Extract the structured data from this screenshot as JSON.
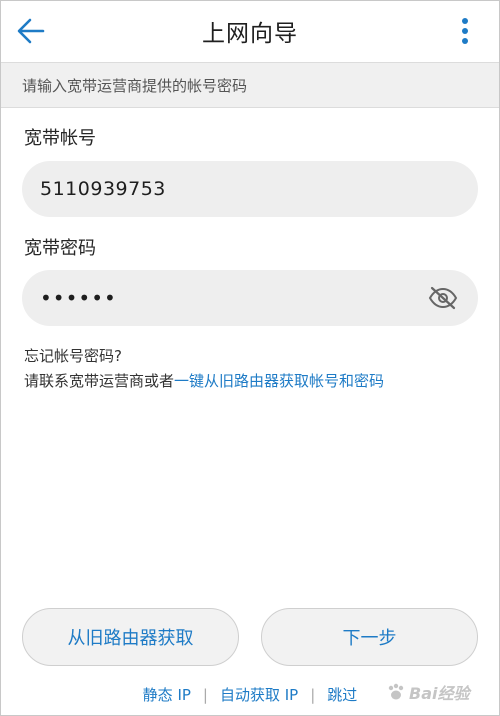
{
  "appbar": {
    "title": "上网向导",
    "back_icon": "arrow-left-icon",
    "more_icon": "more-vert-icon"
  },
  "banner": {
    "text": "请输入宽带运营商提供的帐号密码"
  },
  "account": {
    "label": "宽带帐号",
    "value": "5110939753"
  },
  "password": {
    "label": "宽带密码",
    "value": "••••••",
    "visibility_icon": "eye-off-icon"
  },
  "help": {
    "line1": "忘记帐号密码?",
    "line2_prefix": "请联系宽带运营商或者",
    "line2_link": "一键从旧路由器获取帐号和密码"
  },
  "buttons": {
    "fetch_old_router": "从旧路由器获取",
    "next": "下一步"
  },
  "footer": {
    "static_ip": "静态 IP",
    "auto_ip": "自动获取 IP",
    "skip": "跳过"
  },
  "watermark": {
    "text": "Bai经验"
  },
  "colors": {
    "accent": "#1e7bc6",
    "field_bg": "#eeeeee",
    "banner_bg": "#f0f0f0"
  }
}
